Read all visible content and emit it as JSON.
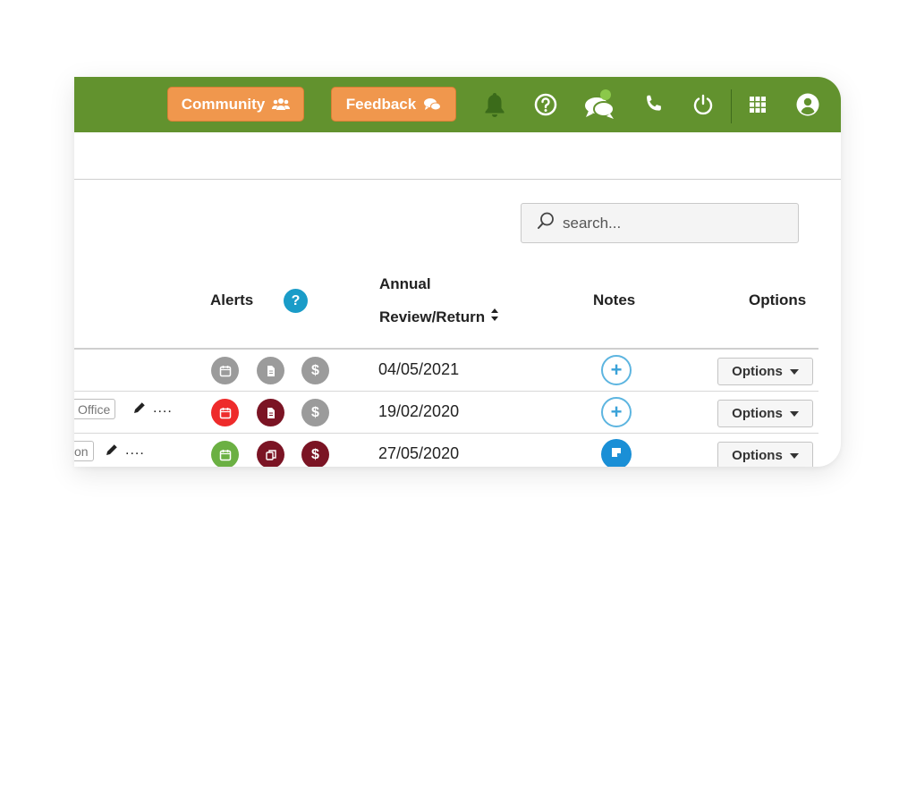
{
  "colors": {
    "topbar": "#62922e",
    "pill": "#f0974d",
    "help": "#1a9cc8",
    "notes_blue": "#1a8fd6"
  },
  "header": {
    "community_label": "Community",
    "feedback_label": "Feedback",
    "icons": [
      "bell-icon",
      "help-circle-icon",
      "chat-icon",
      "phone-icon",
      "power-icon",
      "apps-grid-icon",
      "user-icon"
    ]
  },
  "search": {
    "placeholder": "search..."
  },
  "table": {
    "columns": {
      "alerts": "Alerts",
      "alerts_help": "?",
      "annual_line1": "Annual",
      "annual_line2": "Review/Return",
      "notes": "Notes",
      "options": "Options"
    },
    "rows": [
      {
        "tag": "",
        "date": "04/05/2021",
        "alerts": [
          "gray-calendar",
          "gray-document",
          "gray-dollar"
        ],
        "note": "add",
        "options_label": "Options"
      },
      {
        "tag": "Office",
        "dots": "....",
        "date": "19/02/2020",
        "alerts": [
          "red-calendar",
          "maroon-document",
          "gray-dollar"
        ],
        "note": "add",
        "options_label": "Options"
      },
      {
        "tag": "on",
        "dots": "....",
        "date": "27/05/2020",
        "alerts": [
          "green-calendar",
          "maroon-copy",
          "maroon-dollar"
        ],
        "note": "filled",
        "options_label": "Options"
      }
    ],
    "dollar_symbol": "$"
  }
}
